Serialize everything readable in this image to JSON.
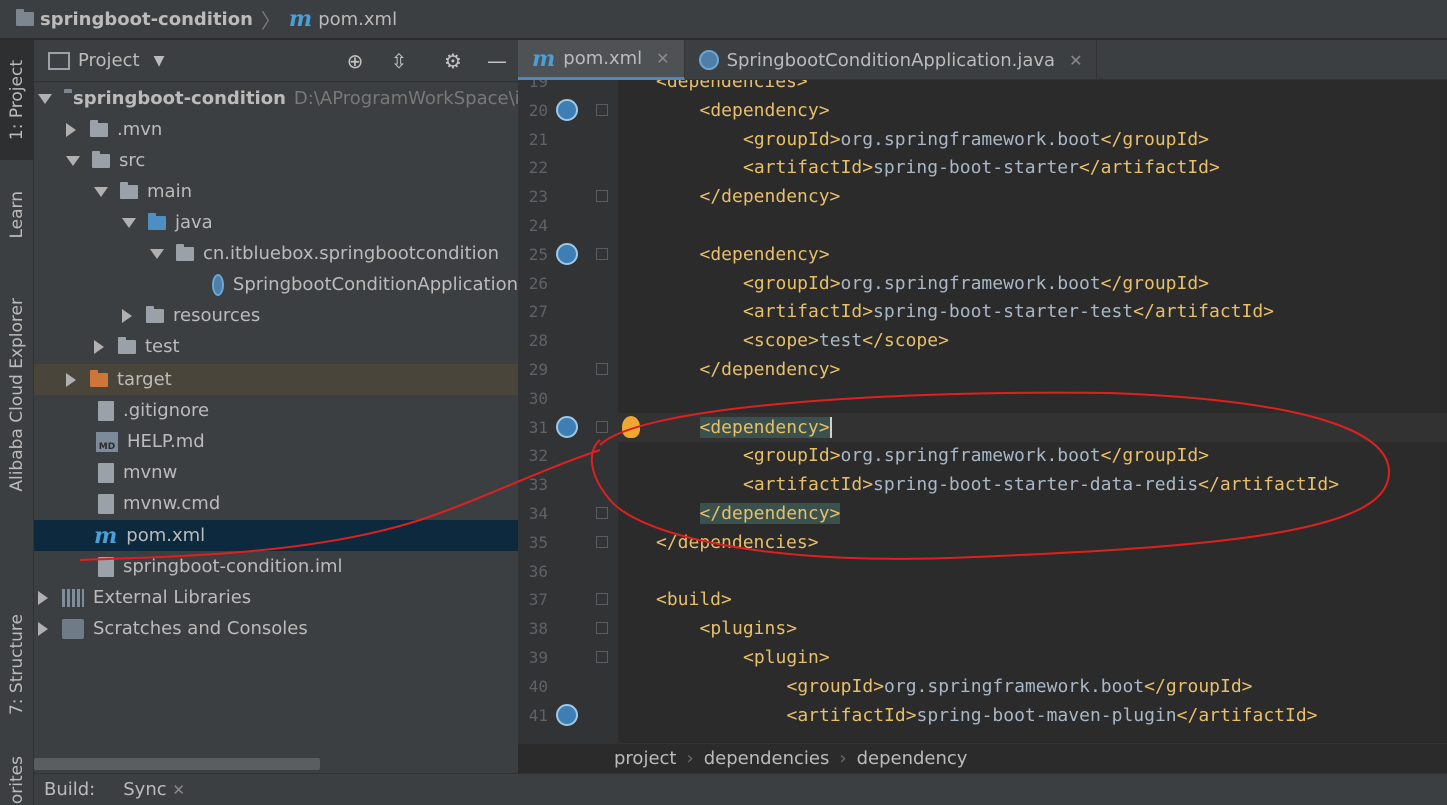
{
  "navbar": {
    "project": "springboot-condition",
    "file": "pom.xml"
  },
  "left_strip": [
    "1: Project",
    "Learn",
    "Alibaba Cloud Explorer",
    "7: Structure",
    "orites"
  ],
  "project_panel": {
    "title": "Project",
    "tree": [
      {
        "label": "springboot-condition",
        "path": "D:\\AProgramWorkSpace\\ide"
      },
      {
        "label": ".mvn"
      },
      {
        "label": "src"
      },
      {
        "label": "main"
      },
      {
        "label": "java"
      },
      {
        "label": "cn.itbluebox.springbootcondition"
      },
      {
        "label": "SpringbootConditionApplication"
      },
      {
        "label": "resources"
      },
      {
        "label": "test"
      },
      {
        "label": "target"
      },
      {
        "label": ".gitignore"
      },
      {
        "label": "HELP.md"
      },
      {
        "label": "mvnw"
      },
      {
        "label": "mvnw.cmd"
      },
      {
        "label": "pom.xml"
      },
      {
        "label": "springboot-condition.iml"
      },
      {
        "label": "External Libraries"
      },
      {
        "label": "Scratches and Consoles"
      }
    ]
  },
  "editor": {
    "tabs": [
      {
        "label": "pom.xml",
        "active": true
      },
      {
        "label": "SpringbootConditionApplication.java",
        "active": false
      }
    ],
    "lines": [
      {
        "n": "19",
        "indent": 1,
        "parts": [
          [
            "tag",
            "<dependencies>"
          ]
        ]
      },
      {
        "n": "20",
        "indent": 2,
        "parts": [
          [
            "tag",
            "<dependency>"
          ]
        ]
      },
      {
        "n": "21",
        "indent": 3,
        "parts": [
          [
            "tag",
            "<groupId>"
          ],
          [
            "txt",
            "org.springframework.boot"
          ],
          [
            "tag",
            "</groupId>"
          ]
        ]
      },
      {
        "n": "22",
        "indent": 3,
        "parts": [
          [
            "tag",
            "<artifactId>"
          ],
          [
            "txt",
            "spring-boot-starter"
          ],
          [
            "tag",
            "</artifactId>"
          ]
        ]
      },
      {
        "n": "23",
        "indent": 2,
        "parts": [
          [
            "tag",
            "</dependency>"
          ]
        ]
      },
      {
        "n": "24",
        "indent": 0,
        "parts": []
      },
      {
        "n": "25",
        "indent": 2,
        "parts": [
          [
            "tag",
            "<dependency>"
          ]
        ]
      },
      {
        "n": "26",
        "indent": 3,
        "parts": [
          [
            "tag",
            "<groupId>"
          ],
          [
            "txt",
            "org.springframework.boot"
          ],
          [
            "tag",
            "</groupId>"
          ]
        ]
      },
      {
        "n": "27",
        "indent": 3,
        "parts": [
          [
            "tag",
            "<artifactId>"
          ],
          [
            "txt",
            "spring-boot-starter-test"
          ],
          [
            "tag",
            "</artifactId>"
          ]
        ]
      },
      {
        "n": "28",
        "indent": 3,
        "parts": [
          [
            "tag",
            "<scope>"
          ],
          [
            "txt",
            "test"
          ],
          [
            "tag",
            "</scope>"
          ]
        ]
      },
      {
        "n": "29",
        "indent": 2,
        "parts": [
          [
            "tag",
            "</dependency>"
          ]
        ]
      },
      {
        "n": "30",
        "indent": 0,
        "parts": []
      },
      {
        "n": "31",
        "indent": 2,
        "parts": [
          [
            "hl",
            "<dependency>"
          ]
        ]
      },
      {
        "n": "32",
        "indent": 3,
        "parts": [
          [
            "tag",
            "<groupId>"
          ],
          [
            "txt",
            "org.springframework.boot"
          ],
          [
            "tag",
            "</groupId>"
          ]
        ]
      },
      {
        "n": "33",
        "indent": 3,
        "parts": [
          [
            "tag",
            "<artifactId>"
          ],
          [
            "txt",
            "spring-boot-starter-data-redis"
          ],
          [
            "tag",
            "</artifactId>"
          ]
        ]
      },
      {
        "n": "34",
        "indent": 2,
        "parts": [
          [
            "hl",
            "</dependency>"
          ]
        ]
      },
      {
        "n": "35",
        "indent": 1,
        "parts": [
          [
            "tag",
            "</dependencies>"
          ]
        ]
      },
      {
        "n": "36",
        "indent": 0,
        "parts": []
      },
      {
        "n": "37",
        "indent": 1,
        "parts": [
          [
            "tag",
            "<build>"
          ]
        ]
      },
      {
        "n": "38",
        "indent": 2,
        "parts": [
          [
            "tag",
            "<plugins>"
          ]
        ]
      },
      {
        "n": "39",
        "indent": 3,
        "parts": [
          [
            "tag",
            "<plugin>"
          ]
        ]
      },
      {
        "n": "40",
        "indent": 4,
        "parts": [
          [
            "tag",
            "<groupId>"
          ],
          [
            "txt",
            "org.springframework.boot"
          ],
          [
            "tag",
            "</groupId>"
          ]
        ]
      },
      {
        "n": "41",
        "indent": 4,
        "parts": [
          [
            "tag",
            "<artifactId>"
          ],
          [
            "txt",
            "spring-boot-maven-plugin"
          ],
          [
            "tag",
            "</artifactId>"
          ]
        ]
      }
    ]
  },
  "breadcrumb": [
    "project",
    "dependencies",
    "dependency"
  ],
  "bottom": {
    "build": "Build:",
    "sync": "Sync"
  },
  "colors": {
    "tag": "#e8bf6a",
    "text": "#a9b7c6",
    "annotation": "#e0201f",
    "selection": "#0d293e"
  }
}
